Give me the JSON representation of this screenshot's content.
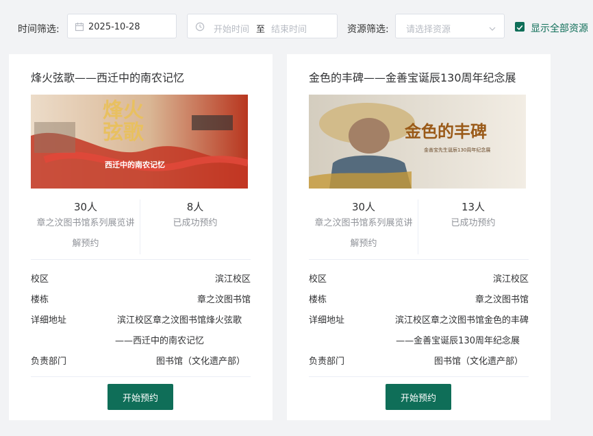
{
  "filters": {
    "time_label": "时间筛选:",
    "date_value": "2025-10-28",
    "start_placeholder": "开始时间",
    "range_separator": "至",
    "end_placeholder": "结束时间",
    "resource_label": "资源筛选:",
    "resource_placeholder": "请选择资源",
    "show_all_label": "显示全部资源",
    "show_all_checked": true
  },
  "colors": {
    "accent": "#0f6e58",
    "page_bg": "#f2f3f5"
  },
  "cards": [
    {
      "title": "烽火弦歌——西迁中的南农记忆",
      "banner": {
        "headline": "烽火弦歌",
        "subtitle": "西迁中的南农记忆"
      },
      "capacity": "30人",
      "capacity_desc_line1": "章之汶图书馆系列展览讲",
      "capacity_desc_line2": "解预约",
      "booked": "8人",
      "booked_desc": "已成功预约",
      "campus_label": "校区",
      "campus": "滨江校区",
      "building_label": "楼栋",
      "building": "章之汶图书馆",
      "address_label": "详细地址",
      "address_line1": "滨江校区章之汶图书馆烽火弦歌",
      "address_line2": "——西迁中的南农记忆",
      "dept_label": "负责部门",
      "dept": "图书馆（文化遗产部）",
      "button": "开始预约"
    },
    {
      "title": "金色的丰碑——金善宝诞辰130周年纪念展",
      "banner": {
        "headline": "金色的丰碑",
        "subtitle": "金善宝先生诞辰130周年纪念展"
      },
      "capacity": "30人",
      "capacity_desc_line1": "章之汶图书馆系列展览讲",
      "capacity_desc_line2": "解预约",
      "booked": "13人",
      "booked_desc": "已成功预约",
      "campus_label": "校区",
      "campus": "滨江校区",
      "building_label": "楼栋",
      "building": "章之汶图书馆",
      "address_label": "详细地址",
      "address_line1": "滨江校区章之汶图书馆金色的丰碑",
      "address_line2": "——金善宝诞辰130周年纪念展",
      "dept_label": "负责部门",
      "dept": "图书馆（文化遗产部）",
      "button": "开始预约"
    }
  ]
}
